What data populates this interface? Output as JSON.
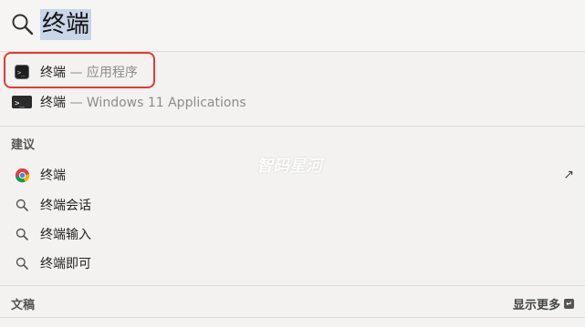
{
  "search": {
    "query": "终端"
  },
  "top_results": [
    {
      "name": "终端",
      "suffix": " — 应用程序",
      "icon": "terminal-icon"
    },
    {
      "name": "终端",
      "suffix": " — Windows 11 Applications",
      "icon": "windows-terminal-icon"
    }
  ],
  "suggestions": {
    "header": "建议",
    "items": [
      {
        "label": "终端",
        "icon": "chrome-icon",
        "arrow": "↗"
      },
      {
        "label": "终端会话",
        "icon": "search-icon"
      },
      {
        "label": "终端输入",
        "icon": "search-icon"
      },
      {
        "label": "终端即可",
        "icon": "search-icon"
      }
    ]
  },
  "documents": {
    "header": "文稿",
    "show_more": "显示更多"
  },
  "watermark": "智码星河",
  "colors": {
    "highlight_border": "#e23b2e",
    "selection": "#c9d5e8"
  }
}
